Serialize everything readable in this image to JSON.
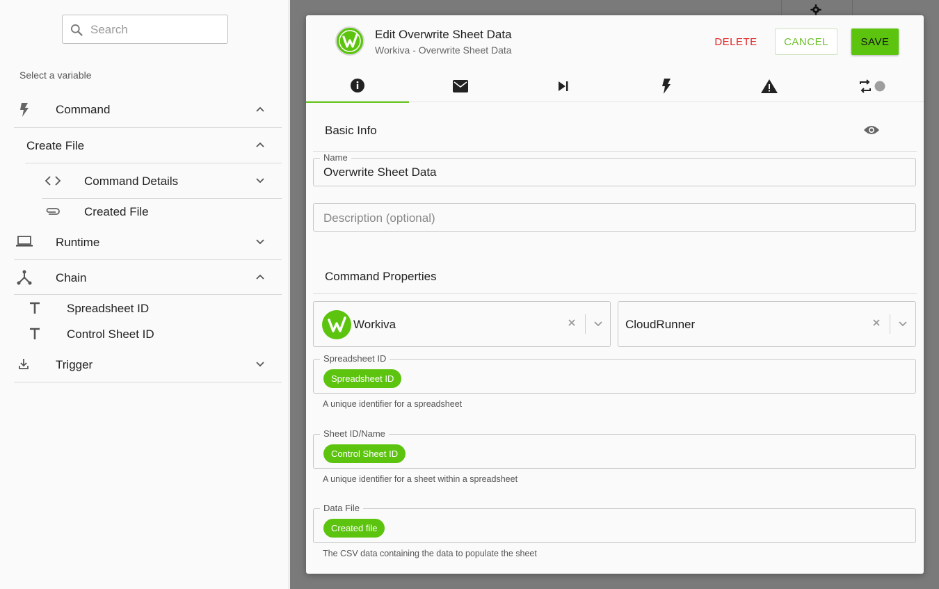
{
  "sidebar": {
    "search_placeholder": "Search",
    "select_label": "Select a variable",
    "items": {
      "command": "Command",
      "create_file": "Create File",
      "command_details": "Command Details",
      "created_file": "Created File",
      "runtime": "Runtime",
      "chain": "Chain",
      "spreadsheet_id": "Spreadsheet ID",
      "control_sheet_id": "Control Sheet ID",
      "trigger": "Trigger"
    }
  },
  "dialog": {
    "title": "Edit Overwrite Sheet Data",
    "subtitle": "Workiva - Overwrite Sheet Data",
    "delete_label": "DELETE",
    "cancel_label": "CANCEL",
    "save_label": "SAVE",
    "tabs": [
      "info-icon",
      "mail-icon",
      "skip-next-icon",
      "bolt-icon",
      "warning-icon",
      "repeat-icon"
    ],
    "basic_info_title": "Basic Info",
    "name_label": "Name",
    "name_value": "Overwrite Sheet Data",
    "description_placeholder": "Description (optional)",
    "command_properties_title": "Command Properties",
    "integration_value": "Workiva",
    "runner_value": "CloudRunner",
    "spreadsheet": {
      "label": "Spreadsheet ID",
      "chip": "Spreadsheet ID",
      "help": "A unique identifier for a spreadsheet"
    },
    "sheet": {
      "label": "Sheet ID/Name",
      "chip": "Control Sheet ID",
      "help": "A unique identifier for a sheet within a spreadsheet"
    },
    "data_file": {
      "label": "Data File",
      "chip": "Created file",
      "help": "The CSV data containing the data to populate the sheet"
    }
  },
  "colors": {
    "accent": "#5cc40e",
    "danger": "#e02020",
    "backdrop": "#7a7a7a"
  }
}
